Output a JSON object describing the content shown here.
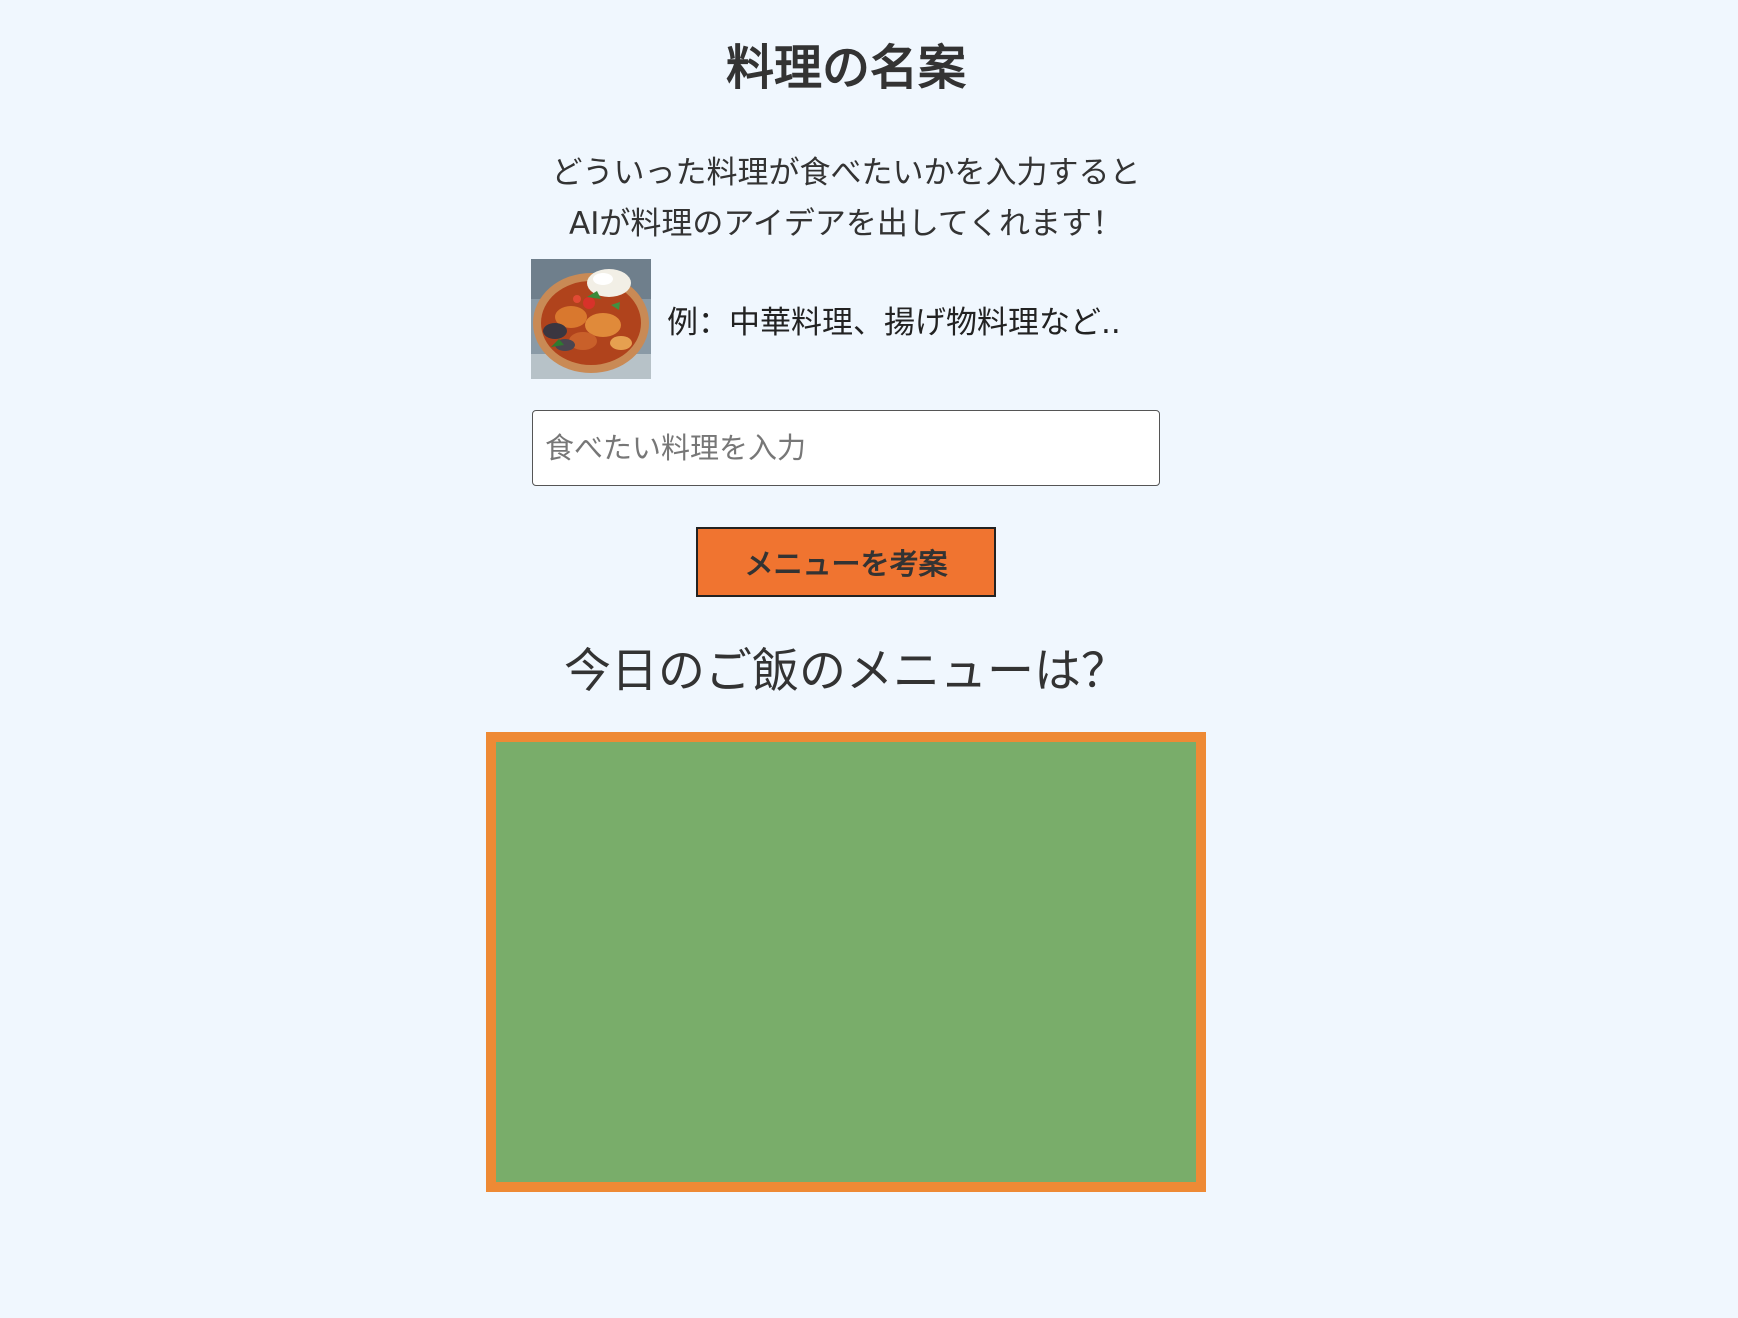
{
  "app": {
    "title": "料理の名案"
  },
  "intro": {
    "line1": "どういった料理が食べたいかを入力すると",
    "line2": "AIが料理のアイデアを出してくれます！"
  },
  "example": {
    "image_icon": "food-dish-photo",
    "text": "例：中華料理、揚げ物料理など.."
  },
  "search": {
    "value": "",
    "placeholder": "食べたい料理を入力"
  },
  "actions": {
    "suggest_label": "メニューを考案"
  },
  "result": {
    "heading": "今日のご飯のメニューは？",
    "content": ""
  },
  "colors": {
    "background": "#f0f7fe",
    "button": "#f07430",
    "result_border": "#ee8a35",
    "result_fill": "#79ad6a"
  }
}
